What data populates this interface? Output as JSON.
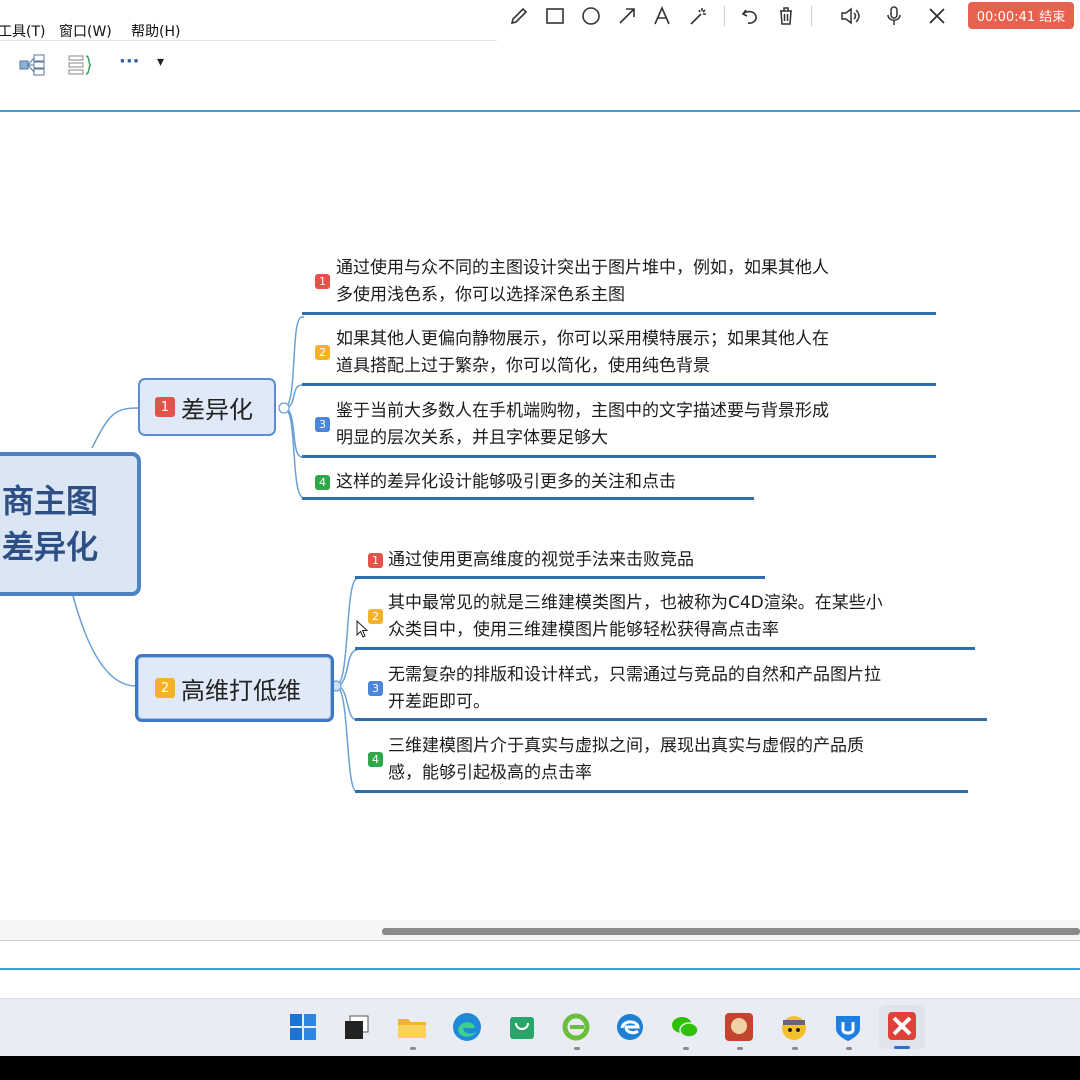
{
  "menu": {
    "items": [
      "工具(T)",
      "窗口(W)",
      "帮助(H)"
    ]
  },
  "toolbar": {
    "more_label": "···",
    "dropdown": "▾"
  },
  "annotation_bar": {
    "tools": [
      "pencil-icon",
      "rectangle-icon",
      "circle-icon",
      "arrow-icon",
      "text-icon",
      "magic-wand-icon",
      "undo-icon",
      "trash-icon",
      "speaker-icon",
      "microphone-icon",
      "close-icon"
    ],
    "timer": "00:00:41 结束",
    "accent": "#e8614e"
  },
  "mindmap": {
    "root": {
      "line1": "商主图",
      "line2": "差异化"
    },
    "branches": [
      {
        "badge": "1",
        "label": "差异化",
        "items": [
          {
            "badge": "1",
            "lines": [
              "通过使用与众不同的主图设计突出于图片堆中，例如，如果其他人",
              "多使用浅色系，你可以选择深色系主图"
            ]
          },
          {
            "badge": "2",
            "lines": [
              "如果其他人更偏向静物展示，你可以采用模特展示；如果其他人在",
              "道具搭配上过于繁杂，你可以简化，使用纯色背景"
            ]
          },
          {
            "badge": "3",
            "lines": [
              "鉴于当前大多数人在手机端购物，主图中的文字描述要与背景形成",
              "明显的层次关系，并且字体要足够大"
            ]
          },
          {
            "badge": "4",
            "lines": [
              "这样的差异化设计能够吸引更多的关注和点击"
            ]
          }
        ]
      },
      {
        "badge": "2",
        "label": "高维打低维",
        "items": [
          {
            "badge": "1",
            "lines": [
              "通过使用更高维度的视觉手法来击败竞品"
            ]
          },
          {
            "badge": "2",
            "lines": [
              "其中最常见的就是三维建模类图片，也被称为C4D渲染。在某些小",
              "众类目中，使用三维建模图片能够轻松获得高点击率"
            ]
          },
          {
            "badge": "3",
            "lines": [
              "无需复杂的排版和设计样式，只需通过与竞品的自然和产品图片拉",
              "开差距即可。"
            ]
          },
          {
            "badge": "4",
            "lines": [
              "三维建模图片介于真实与虚拟之间，展现出真实与虚假的产品质",
              "感，能够引起极高的点击率"
            ]
          }
        ]
      }
    ]
  },
  "taskbar": {
    "icons": [
      "start-icon",
      "task-view-icon",
      "file-explorer-icon",
      "edge-icon",
      "store-icon",
      "ie-icon",
      "edge-legacy-icon",
      "wechat-icon",
      "app-icon",
      "naruto-app-icon",
      "shield-app-icon",
      "xmind-icon"
    ]
  }
}
